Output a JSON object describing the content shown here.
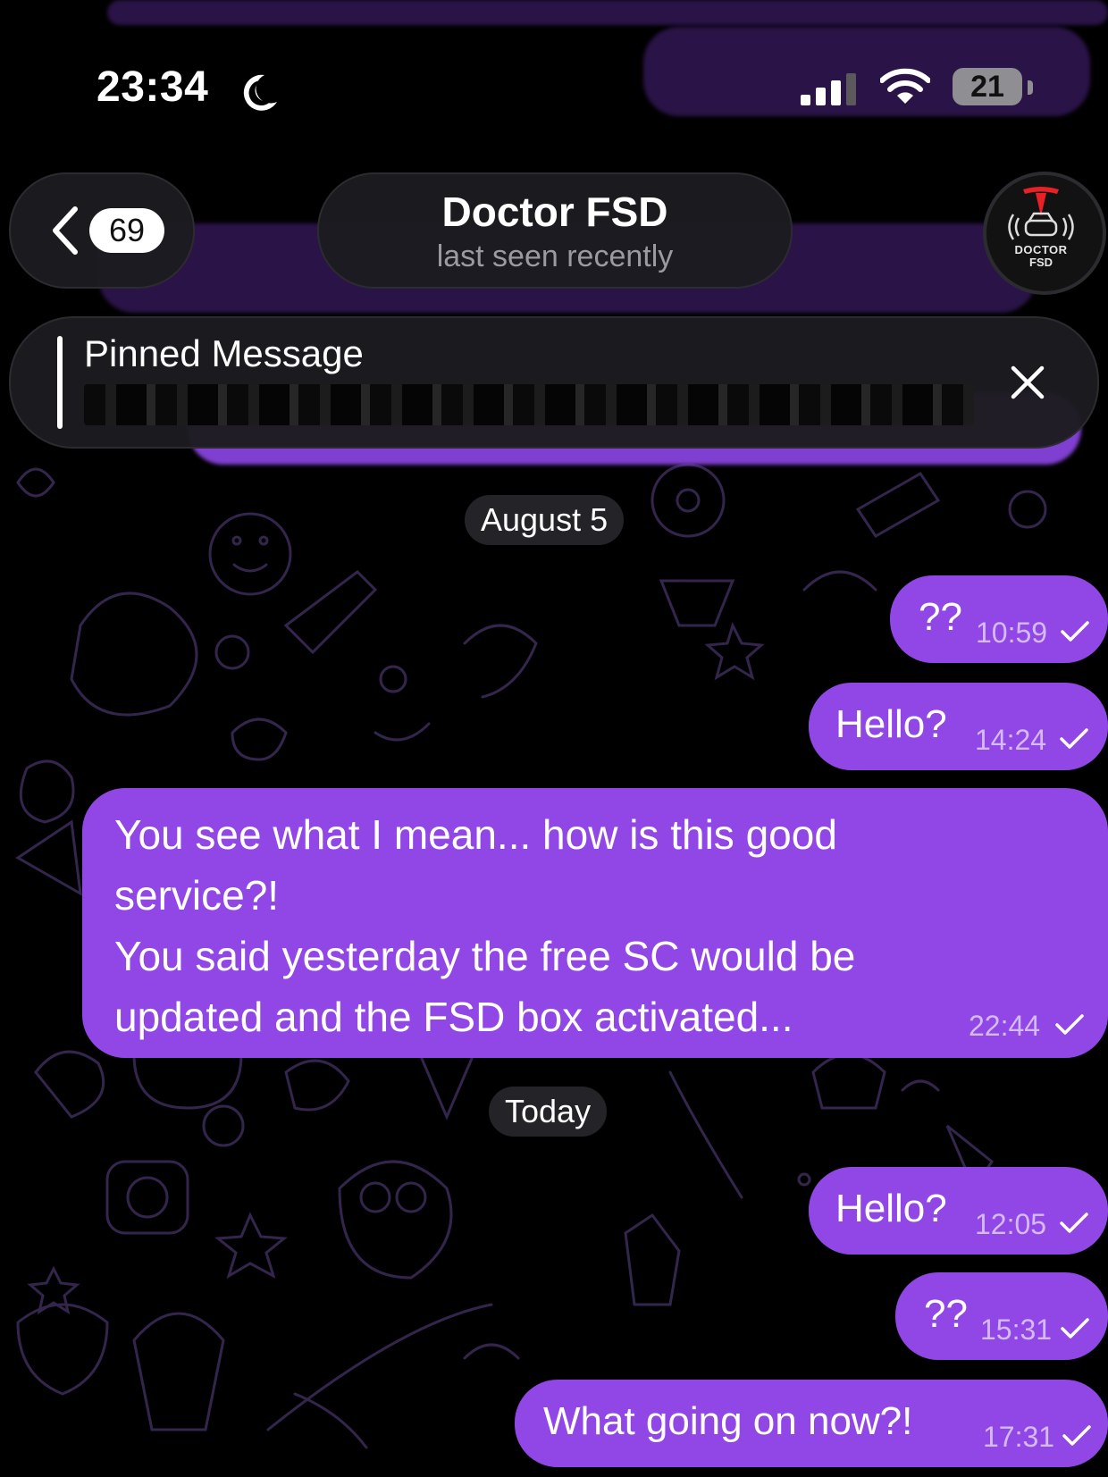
{
  "status_bar": {
    "time": "23:34",
    "battery": "21",
    "icons": [
      "moon-icon",
      "signal-icon",
      "wifi-icon",
      "battery-icon"
    ]
  },
  "header": {
    "back_badge": "69",
    "title": "Doctor FSD",
    "subtitle": "last seen recently",
    "avatar_text": [
      "DOCTOR",
      "FSD"
    ]
  },
  "pinned": {
    "label": "Pinned Message"
  },
  "messages": [
    {
      "type": "date",
      "text": "August 5"
    },
    {
      "type": "out",
      "text": "??",
      "time": "10:59"
    },
    {
      "type": "out",
      "text": "Hello?",
      "time": "14:24"
    },
    {
      "type": "out",
      "lines": [
        "You see what I mean... how is this good",
        "service?!",
        "You said yesterday the free SC would be",
        "updated and the FSD box activated..."
      ],
      "time": "22:44"
    },
    {
      "type": "date",
      "text": "Today"
    },
    {
      "type": "out",
      "text": "Hello?",
      "time": "12:05"
    },
    {
      "type": "out",
      "text": "??",
      "time": "15:31"
    },
    {
      "type": "out",
      "text": "What going on now?!",
      "time": "17:31"
    }
  ],
  "colors": {
    "bubble": "#9147e6",
    "background": "#000000",
    "pattern": "#3a2a55",
    "accent_red": "#e82127"
  }
}
